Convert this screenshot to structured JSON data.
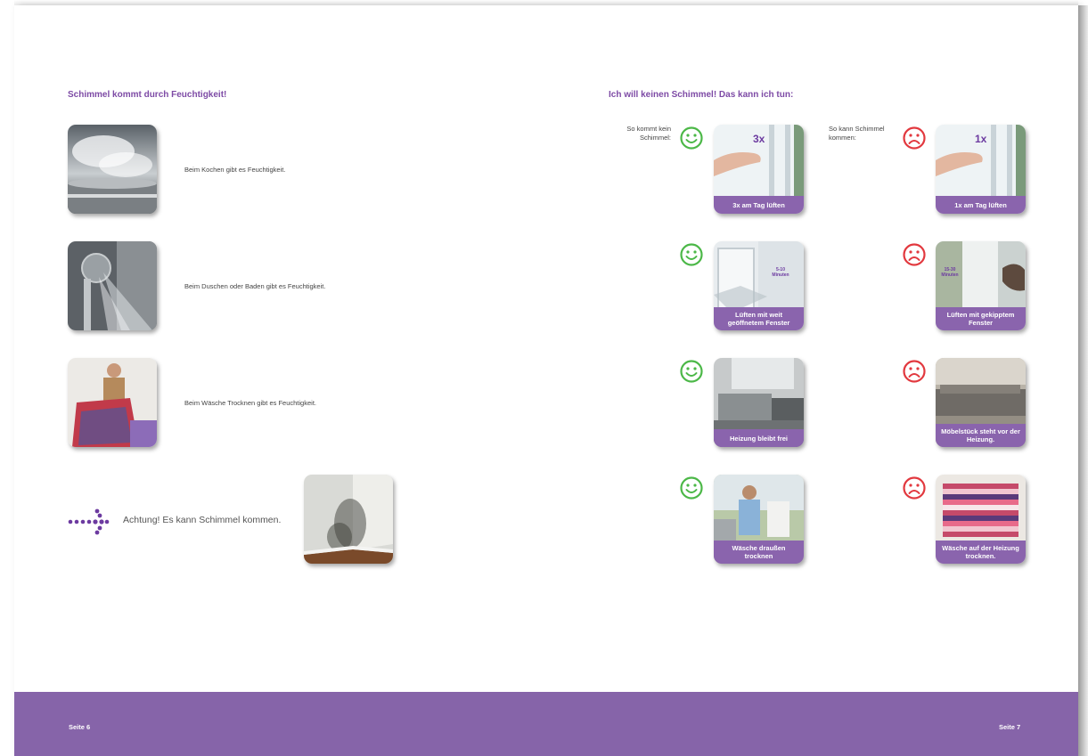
{
  "left": {
    "heading": "Schimmel kommt durch Feuchtigkeit!",
    "rows": [
      {
        "caption": "Beim Kochen gibt es Feuchtigkeit."
      },
      {
        "caption": "Beim Duschen oder Baden gibt es Feuchtigkeit."
      },
      {
        "caption": "Beim Wäsche Trocknen gibt es Feuchtigkeit."
      }
    ],
    "warning": "Achtung! Es kann Schimmel kommen."
  },
  "right": {
    "heading": "Ich will keinen Schimmel! Das kann ich tun:",
    "good_label": "So kommt kein Schimmel:",
    "bad_label": "So kann Schimmel kommen:",
    "good_tiles": [
      {
        "label": "3x am Tag lüften",
        "badge": "3x"
      },
      {
        "label": "Lüften mit weit geöffnetem Fenster",
        "minutes": "5-10 Minuten"
      },
      {
        "label": "Heizung bleibt frei"
      },
      {
        "label": "Wäsche draußen trocknen"
      }
    ],
    "bad_tiles": [
      {
        "label": "1x am Tag lüften",
        "badge": "1x"
      },
      {
        "label": "Lüften mit gekipptem Fenster",
        "minutes": "15-30 Minuten"
      },
      {
        "label": "Möbelstück steht vor der Heizung."
      },
      {
        "label": "Wäsche auf der Heizung trocknen."
      }
    ],
    "good_icon": "happy-smiley-icon",
    "bad_icon": "sad-smiley-icon"
  },
  "footer": {
    "page_left": "Seite 6",
    "page_right": "Seite 7"
  },
  "colors": {
    "accent": "#7d4aa5",
    "footer": "#8664a9",
    "good": "#4cb848",
    "bad": "#e2393f"
  }
}
